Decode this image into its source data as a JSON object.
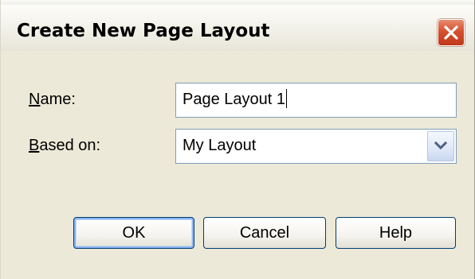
{
  "dialog": {
    "title": "Create New Page Layout",
    "close_icon": "close-icon",
    "accent_color": "#d5502d"
  },
  "form": {
    "name_label_mnemonic": "N",
    "name_label_rest": "ame:",
    "name_value": "Page Layout 1",
    "based_on_label_mnemonic": "B",
    "based_on_label_rest": "ased on:",
    "based_on_value": "My Layout",
    "dropdown_icon": "chevron-down-icon"
  },
  "buttons": {
    "ok_label": "OK",
    "cancel_label": "Cancel",
    "help_label": "Help"
  }
}
